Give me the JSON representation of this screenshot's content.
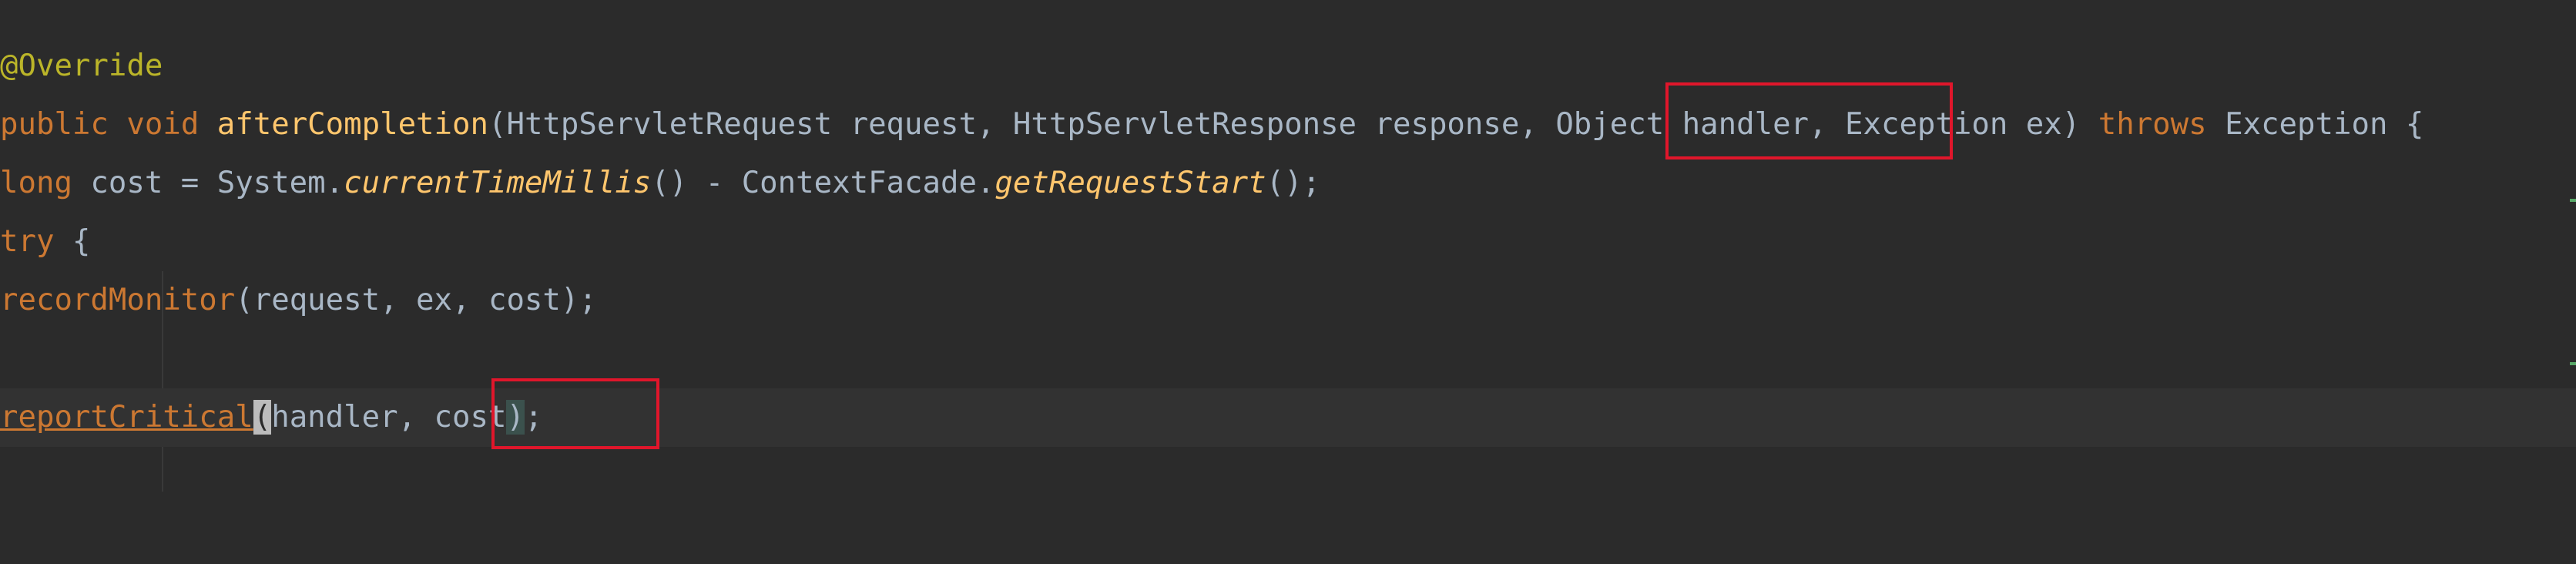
{
  "editor": {
    "lines": {
      "annotation": "@Override",
      "sig_public": "public",
      "sig_void": "void",
      "sig_method": "afterCompletion",
      "sig_params_a": "(HttpServletRequest request, HttpServletResponse response, ",
      "sig_params_handler": "Object handler",
      "sig_params_b": ", Exception ex) ",
      "sig_throws": "throws",
      "sig_tail": " Exception {",
      "l3_long": "long",
      "l3_a": " cost = System.",
      "l3_ctm": "currentTimeMillis",
      "l3_b": "() - ContextFacade.",
      "l3_grs": "getRequestStart",
      "l3_c": "();",
      "l4_try": "try",
      "l4_brace": " {",
      "l5_call": "recordMonitor",
      "l5_args": "(request, ex, cost);",
      "l7_call": "reportCritical",
      "l7_caret": "(",
      "l7_args": "handler, cost",
      "l7_close": ")",
      "l7_end": ";"
    },
    "colors": {
      "background": "#2b2b2b",
      "keyword": "#cc7832",
      "method": "#ffc66d",
      "annotation": "#bbb529",
      "text": "#a9b7c6",
      "highlight_box": "#e0162b"
    }
  }
}
